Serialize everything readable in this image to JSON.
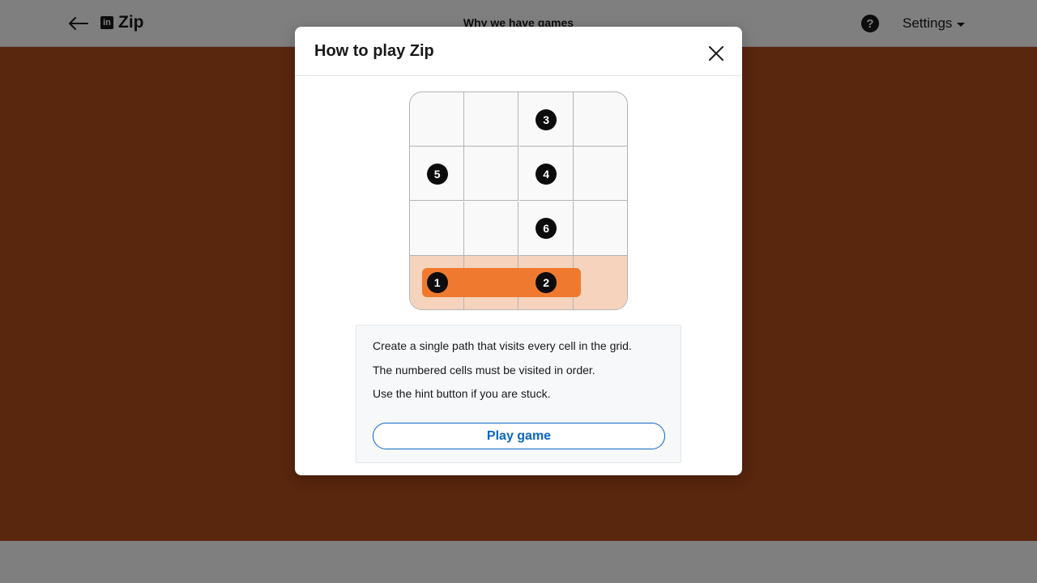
{
  "header": {
    "app_name": "Zip",
    "brand_logo_text": "in",
    "center_link": "Why we have games",
    "help_icon_text": "?",
    "settings_label": "Settings"
  },
  "modal": {
    "title": "How to play Zip",
    "grid": {
      "rows": 4,
      "cols": 4,
      "numbers": [
        {
          "label": "3",
          "row": 0,
          "col": 2
        },
        {
          "label": "5",
          "row": 1,
          "col": 0
        },
        {
          "label": "4",
          "row": 1,
          "col": 2
        },
        {
          "label": "6",
          "row": 2,
          "col": 2
        },
        {
          "label": "1",
          "row": 3,
          "col": 0
        },
        {
          "label": "2",
          "row": 3,
          "col": 2
        }
      ],
      "path_color": "#ef7a2f",
      "visited_row_color": "#f5d3bd"
    },
    "instructions": [
      "Create a single path that visits every cell in the grid.",
      "The numbered cells must be visited in order.",
      "Use the hint button if you are stuck."
    ],
    "play_button_label": "Play game"
  },
  "colors": {
    "game_background": "#b34c1d",
    "accent": "#0a66c2"
  }
}
